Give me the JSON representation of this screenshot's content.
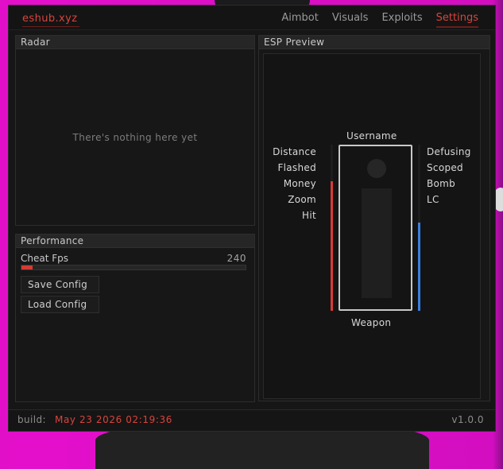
{
  "app": {
    "title": "eshub.xyz"
  },
  "tabs": [
    {
      "label": "Aimbot",
      "active": false
    },
    {
      "label": "Visuals",
      "active": false
    },
    {
      "label": "Exploits",
      "active": false
    },
    {
      "label": "Settings",
      "active": true
    }
  ],
  "radar": {
    "title": "Radar",
    "empty_text": "There's nothing here yet"
  },
  "performance": {
    "title": "Performance",
    "cheat_fps_label": "Cheat Fps",
    "cheat_fps_value": "240",
    "cheat_fps_fraction": 0.05,
    "save_label": "Save Config",
    "load_label": "Load Config"
  },
  "esp": {
    "title": "ESP Preview",
    "username": "Username",
    "weapon": "Weapon",
    "left_labels": [
      "Distance",
      "Flashed",
      "Money",
      "Zoom",
      "Hit"
    ],
    "right_labels": [
      "Defusing",
      "Scoped",
      "Bomb",
      "LC"
    ],
    "health_fraction": 0.78,
    "armor_fraction": 0.53,
    "health_color": "#d93a36",
    "armor_color": "#3b7fe0"
  },
  "footer": {
    "build_label": "build:",
    "build_date": "May 23 2026 02:19:36",
    "version": "v1.0.0"
  },
  "colors": {
    "accent": "#d8443c",
    "background_magenta": "#e20fc8"
  }
}
